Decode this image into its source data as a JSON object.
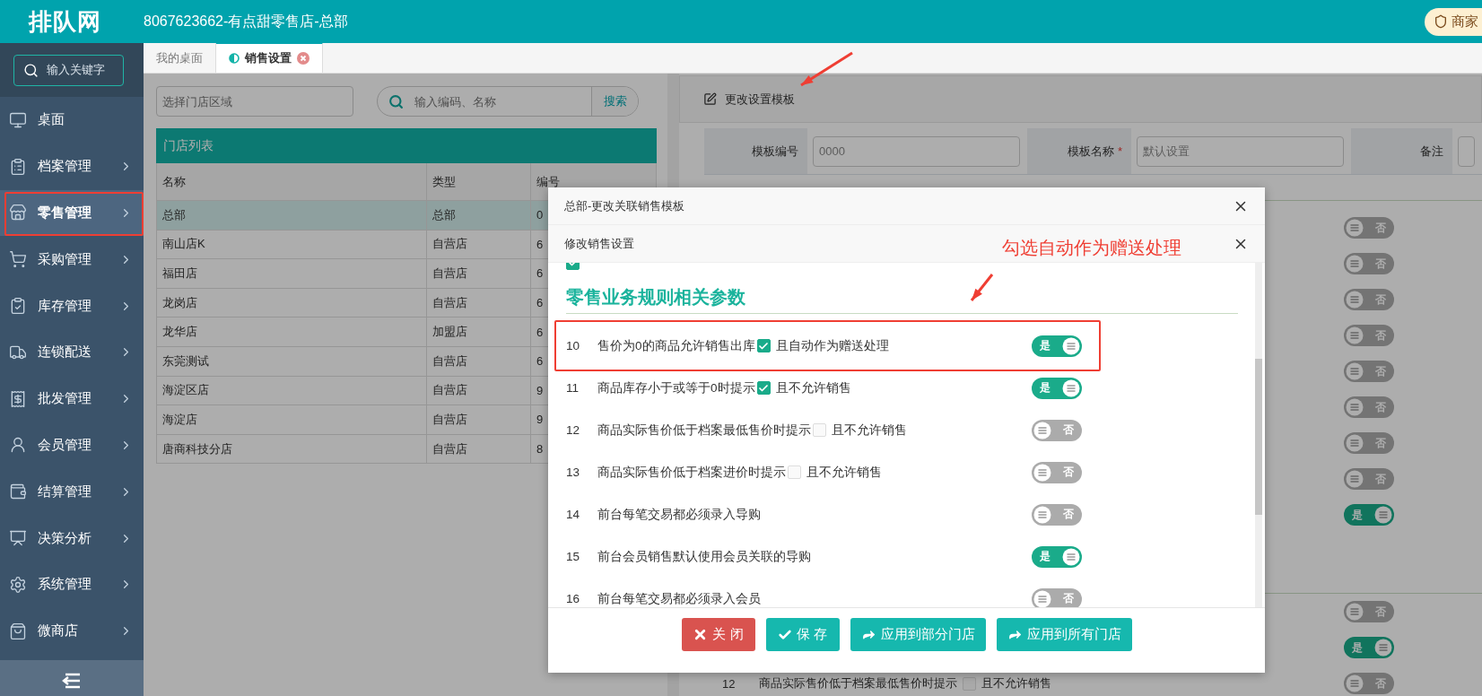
{
  "header": {
    "logo": "排队网",
    "title": "8067623662-有点甜零售店-总部",
    "badge": "商家"
  },
  "sidebar": {
    "search_placeholder": "输入关键字",
    "items": [
      {
        "label": "桌面",
        "selected": false,
        "has_submenu": false,
        "annotated": false
      },
      {
        "label": "档案管理",
        "selected": false,
        "has_submenu": true,
        "annotated": false
      },
      {
        "label": "零售管理",
        "selected": true,
        "has_submenu": true,
        "annotated": true
      },
      {
        "label": "采购管理",
        "selected": false,
        "has_submenu": true,
        "annotated": false
      },
      {
        "label": "库存管理",
        "selected": false,
        "has_submenu": true,
        "annotated": false
      },
      {
        "label": "连锁配送",
        "selected": false,
        "has_submenu": true,
        "annotated": false
      },
      {
        "label": "批发管理",
        "selected": false,
        "has_submenu": true,
        "annotated": false
      },
      {
        "label": "会员管理",
        "selected": false,
        "has_submenu": true,
        "annotated": false
      },
      {
        "label": "结算管理",
        "selected": false,
        "has_submenu": true,
        "annotated": false
      },
      {
        "label": "决策分析",
        "selected": false,
        "has_submenu": true,
        "annotated": false
      },
      {
        "label": "系统管理",
        "selected": false,
        "has_submenu": true,
        "annotated": false
      },
      {
        "label": "微商店",
        "selected": false,
        "has_submenu": true,
        "annotated": false
      }
    ]
  },
  "tabs": [
    {
      "label": "我的桌面",
      "selected": false,
      "closable": false
    },
    {
      "label": "销售设置",
      "selected": true,
      "closable": true
    }
  ],
  "store_panel": {
    "region_placeholder": "选择门店区域",
    "search_placeholder": "输入编码、名称",
    "search_button": "搜索",
    "title": "门店列表",
    "columns": [
      "名称",
      "类型",
      "编号"
    ],
    "rows": [
      {
        "cells": [
          "总部",
          "总部",
          "0"
        ],
        "selected": true
      },
      {
        "cells": [
          "南山店K",
          "自营店",
          "6"
        ],
        "selected": false
      },
      {
        "cells": [
          "福田店",
          "自营店",
          "6"
        ],
        "selected": false
      },
      {
        "cells": [
          "龙岗店",
          "自营店",
          "6"
        ],
        "selected": false
      },
      {
        "cells": [
          "龙华店",
          "加盟店",
          "6"
        ],
        "selected": false
      },
      {
        "cells": [
          "东莞测试",
          "自营店",
          "6"
        ],
        "selected": false
      },
      {
        "cells": [
          "海淀区店",
          "自营店",
          "9"
        ],
        "selected": false
      },
      {
        "cells": [
          "海淀店",
          "自营店",
          "9"
        ],
        "selected": false
      },
      {
        "cells": [
          "唐商科技分店",
          "自营店",
          "8"
        ],
        "selected": false
      }
    ]
  },
  "template_panel": {
    "edit_button": "更改设置模板",
    "fields": [
      {
        "label": "模板编号",
        "value": "0000"
      },
      {
        "label": "模板名称",
        "required_mark": "*",
        "value": "默认设置"
      },
      {
        "label": "备注"
      }
    ],
    "toggles": [
      {
        "on": false,
        "text": "否"
      },
      {
        "on": false,
        "text": "否"
      },
      {
        "on": false,
        "text": "否"
      },
      {
        "on": false,
        "text": "否"
      },
      {
        "on": false,
        "text": "否"
      },
      {
        "on": false,
        "text": "否"
      },
      {
        "on": false,
        "text": "否"
      },
      {
        "on": false,
        "text": "否"
      },
      {
        "on": true,
        "text": "是"
      }
    ],
    "toggles_2": [
      {
        "on": false,
        "text": "否"
      },
      {
        "on": true,
        "text": "是"
      }
    ],
    "last_row": {
      "no": "12",
      "label": "商品实际售价低于档案最低售价时提示",
      "extra": {
        "checked": false,
        "label": "且不允许销售"
      },
      "toggle": {
        "on": false,
        "text": "否"
      }
    }
  },
  "modal": {
    "title": "总部-更改关联销售模板",
    "subtitle": "修改销售设置",
    "note": "勾选自动作为赠送处理",
    "partial_row": {
      "checked": true
    },
    "section_title": "零售业务规则相关参数",
    "rows": [
      {
        "no": "10",
        "label": "售价为0的商品允许销售出库",
        "extra": {
          "checked": true,
          "label": "且自动作为赠送处理"
        },
        "toggle": {
          "on": true,
          "text": "是"
        },
        "highlighted": true
      },
      {
        "no": "11",
        "label": "商品库存小于或等于0时提示",
        "extra": {
          "checked": true,
          "label": "且不允许销售"
        },
        "toggle": {
          "on": true,
          "text": "是"
        },
        "highlighted": false
      },
      {
        "no": "12",
        "label": "商品实际售价低于档案最低售价时提示",
        "extra": {
          "checked": false,
          "label": "且不允许销售"
        },
        "toggle": {
          "on": false,
          "text": "否"
        },
        "highlighted": false
      },
      {
        "no": "13",
        "label": "商品实际售价低于档案进价时提示",
        "extra": {
          "checked": false,
          "label": "且不允许销售"
        },
        "toggle": {
          "on": false,
          "text": "否"
        },
        "highlighted": false
      },
      {
        "no": "14",
        "label": "前台每笔交易都必须录入导购",
        "toggle": {
          "on": false,
          "text": "否"
        },
        "highlighted": false
      },
      {
        "no": "15",
        "label": "前台会员销售默认使用会员关联的导购",
        "toggle": {
          "on": true,
          "text": "是"
        },
        "highlighted": false
      },
      {
        "no": "16",
        "label": "前台每笔交易都必须录入会员",
        "toggle": {
          "on": false,
          "text": "否"
        },
        "highlighted": false
      }
    ],
    "buttons": [
      {
        "label": "关 闭",
        "kind": "close"
      },
      {
        "label": "保 存",
        "kind": "save"
      },
      {
        "label": "应用到部分门店",
        "kind": "apply"
      },
      {
        "label": "应用到所有门店",
        "kind": "apply"
      }
    ]
  }
}
